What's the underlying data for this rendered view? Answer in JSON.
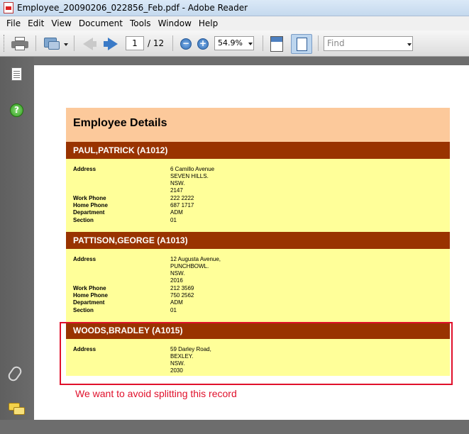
{
  "window": {
    "title": "Employee_20090206_022856_Feb.pdf - Adobe Reader"
  },
  "menu": [
    "File",
    "Edit",
    "View",
    "Document",
    "Tools",
    "Window",
    "Help"
  ],
  "toolbar": {
    "page_current": "1",
    "page_total": "/ 12",
    "zoom": "54.9%",
    "find_placeholder": "Find",
    "icons": [
      "print-icon",
      "collaborate-icon",
      "previous-page-icon",
      "next-page-icon",
      "zoom-out-icon",
      "zoom-in-icon",
      "fit-page-icon",
      "fit-width-icon"
    ]
  },
  "left_panel": {
    "icons": [
      "pages-icon",
      "help-icon",
      "attachments-icon",
      "comments-icon"
    ]
  },
  "report": {
    "title": "Employee Details",
    "records": [
      {
        "name": "PAUL,PATRICK (A1012)",
        "address_label": "Address",
        "address_lines": [
          "6 Camillo Avenue",
          "SEVEN HILLS.",
          "NSW.",
          "2147"
        ],
        "work_phone_label": "Work Phone",
        "work_phone": "222 2222",
        "home_phone_label": "Home Phone",
        "home_phone": "687 1717",
        "department_label": "Department",
        "department": "ADM",
        "section_label": "Section",
        "section": "01"
      },
      {
        "name": "PATTISON,GEORGE (A1013)",
        "address_label": "Address",
        "address_lines": [
          "12 Augusta Avenue,",
          "PUNCHBOWL.",
          "NSW.",
          "2016"
        ],
        "work_phone_label": "Work Phone",
        "work_phone": "212 3569",
        "home_phone_label": "Home Phone",
        "home_phone": "750 2562",
        "department_label": "Department",
        "department": "ADM",
        "section_label": "Section",
        "section": "01"
      },
      {
        "name": "WOODS,BRADLEY (A1015)",
        "address_label": "Address",
        "address_lines": [
          "59 Darley Road,",
          "BEXLEY.",
          "NSW.",
          "2030"
        ]
      }
    ]
  },
  "annotation": {
    "text": "We want to avoid splitting this record",
    "color": "#e0102b"
  },
  "colors": {
    "header_bg": "#fcc99b",
    "record_head_bg": "#993300",
    "record_body_bg": "#ffff99"
  }
}
